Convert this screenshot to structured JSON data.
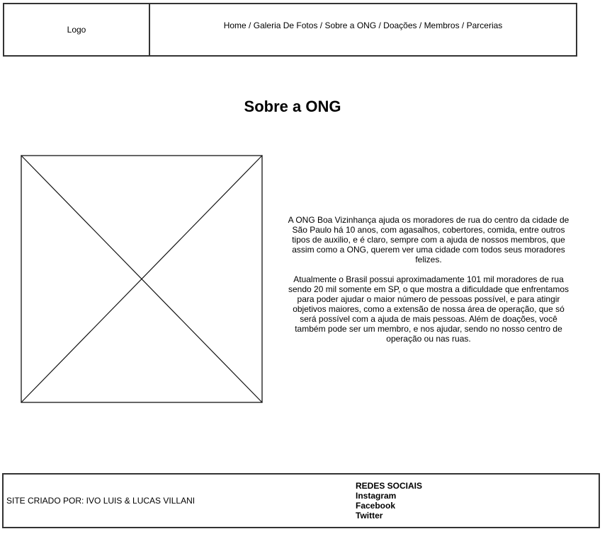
{
  "header": {
    "logo": "Logo",
    "nav": {
      "items": [
        "Home",
        "Galeria De Fotos",
        "Sobre a ONG",
        "Doações",
        "Membros",
        "Parcerias"
      ],
      "separator": " / "
    }
  },
  "main": {
    "title": "Sobre a ONG",
    "paragraphs": [
      "A ONG Boa Vizinhança ajuda os moradores de rua do centro da cidade de São Paulo há 10 anos, com agasalhos, cobertores, comida, entre outros tipos de auxilio, e é claro, sempre com a ajuda de nossos membros, que assim como a ONG, querem ver uma cidade com todos seus moradores felizes.",
      "Atualmente o Brasil possui aproximadamente 101 mil moradores de rua sendo 20 mil somente em SP, o que mostra a dificuldade que enfrentamos para poder ajudar o maior número de pessoas possível, e para atingir objetivos maiores, como a extensão de nossa área de operação, que só será possível com a ajuda de mais pessoas. Além de doações, você também pode ser um membro, e nos ajudar, sendo no nosso centro de operação ou nas ruas."
    ]
  },
  "footer": {
    "credits": "SITE CRIADO POR: IVO LUIS & LUCAS VILLANI",
    "social": {
      "heading": "REDES SOCIAIS",
      "links": [
        "Instagram",
        "Facebook",
        "Twitter"
      ]
    }
  }
}
